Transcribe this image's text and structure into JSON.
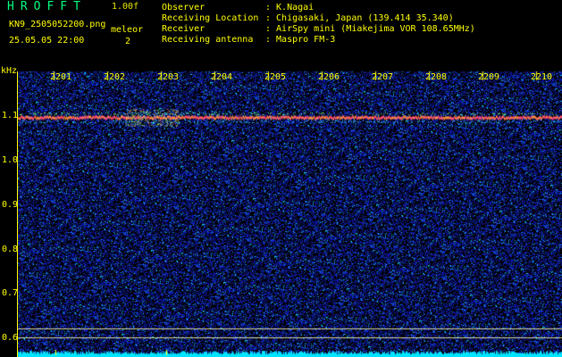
{
  "header": {
    "app_title": "HROFFT",
    "version": "1.00f",
    "filename": "KN9_2505052200.png",
    "mode_label": "meleor",
    "timestamp": "25.05.05 22:00",
    "mode_value": "2"
  },
  "meta": [
    {
      "label": "Observer",
      "value": ": K.Nagai"
    },
    {
      "label": "Receiving Location",
      "value": ": Chigasaki, Japan (139.414 35.340)"
    },
    {
      "label": "Receiver",
      "value": ": AirSpy mini (Miakejima VOR 108.65MHz)"
    },
    {
      "label": "Receiving antenna",
      "value": ": Maspro FM-3"
    }
  ],
  "chart_data": {
    "type": "heatmap",
    "ylabel": "kHz",
    "y_ticks": [
      "1.1",
      "1.0",
      "0.9",
      "0.8",
      "0.7",
      "0.6"
    ],
    "y_tick_values": [
      1.1,
      1.0,
      0.9,
      0.8,
      0.7,
      0.6
    ],
    "x_ticks": [
      "2201",
      "2202",
      "2203",
      "2204",
      "2205",
      "2206",
      "2207",
      "2208",
      "2209",
      "2210"
    ],
    "ylim": [
      0.58,
      1.19
    ],
    "signal_line_khz": 1.095,
    "reference_lines_khz": [
      0.623,
      0.602
    ],
    "colors": {
      "background": "#000000",
      "noise": "#1a2fc8",
      "signal": "#ff3c5a",
      "baseline": "#00e5ff"
    }
  }
}
